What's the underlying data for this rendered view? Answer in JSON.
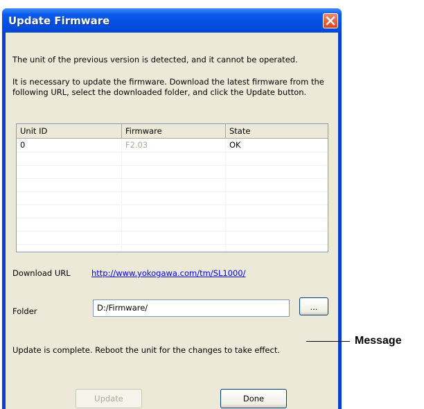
{
  "window": {
    "title": "Update Firmware",
    "close_icon": "close-icon"
  },
  "messages": {
    "detected": "The unit of the previous version is detected, and it cannot be operated.",
    "instructions": "It is necessary to update the firmware. Download the latest firmware from the following URL, select the downloaded folder, and click the Update button."
  },
  "table": {
    "columns": [
      "Unit ID",
      "Firmware",
      "State"
    ],
    "rows": [
      {
        "unit_id": "0",
        "firmware": "F2.03",
        "state": "OK"
      }
    ]
  },
  "download": {
    "label": "Download URL",
    "url": "http://www.yokogawa.com/tm/SL1000/"
  },
  "folder": {
    "label": "Folder",
    "value": "D:/Firmware/",
    "browse_label": "..."
  },
  "status": {
    "message": "Update is complete. Reboot the unit for the changes to take effect."
  },
  "buttons": {
    "update": "Update",
    "done": "Done"
  },
  "annotation": {
    "callout": "Message"
  },
  "colors": {
    "titlebar": "#0550e2",
    "dialog_bg": "#ece9d8",
    "link": "#0000ee",
    "close_button": "#d8431d"
  }
}
